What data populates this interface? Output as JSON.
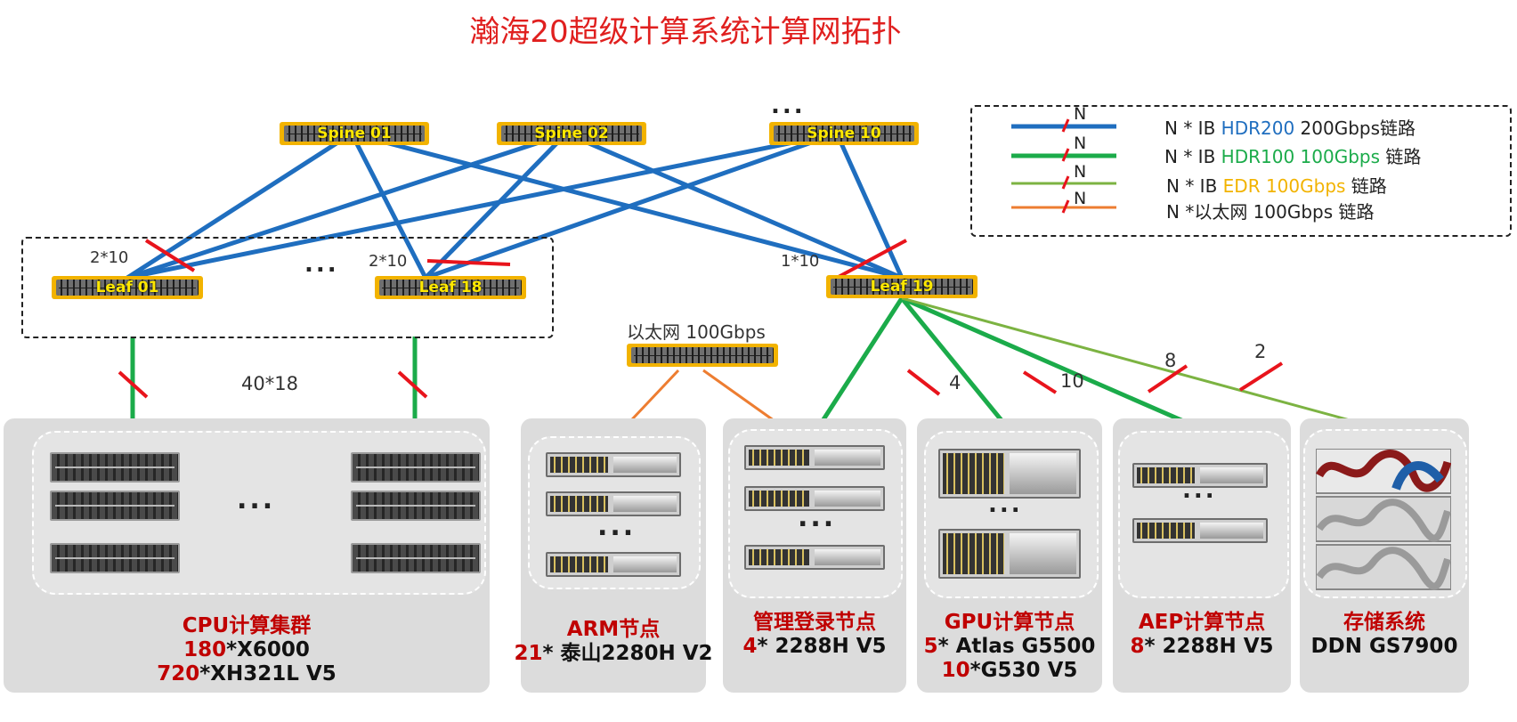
{
  "title": "瀚海20超级计算系统计算网拓扑",
  "colors": {
    "hdr200": "#1f6ebf",
    "hdr100": "#1bab4a",
    "edr": "#7cb342",
    "ethernet": "#ed7d31",
    "switch_frame": "#f2b300",
    "switch_label": "#ffe800",
    "caption_red": "#c00000",
    "slash": "#e8141c"
  },
  "switches": {
    "spine01": "Spine 01",
    "spine02": "Spine 02",
    "spine10": "Spine 10",
    "leaf01": "Leaf 01",
    "leaf18": "Leaf 18",
    "leaf19": "Leaf 19"
  },
  "ellipsis": "...",
  "link_counts": {
    "leaf01": "2*10",
    "leaf18": "2*10",
    "leaf19": "1*10",
    "cpu": "40*18",
    "gpu_hdr100_a": "4",
    "gpu_hdr100_b": "10",
    "aep_hdr100": "8",
    "storage_edr": "2"
  },
  "ethernet_switch_label": "以太网 100Gbps",
  "legend": {
    "marker": "N",
    "rows": [
      {
        "prefix": "N * IB ",
        "highlight": "HDR200",
        "highlight_color": "#1f6ebf",
        "suffix": " 200Gbps链路"
      },
      {
        "prefix": "N * IB ",
        "highlight": "HDR100 100Gbps",
        "highlight_color": "#1bab4a",
        "suffix": " 链路"
      },
      {
        "prefix": "N * IB ",
        "highlight": "EDR 100Gbps",
        "highlight_color": "#f2b300",
        "suffix": " 链路"
      },
      {
        "prefix": "N *以太网 100Gbps 链路",
        "highlight": "",
        "highlight_color": "#222222",
        "suffix": ""
      }
    ]
  },
  "groups": [
    {
      "name": "CPU计算集群",
      "lines": [
        {
          "count": "180",
          "model": "*X6000"
        },
        {
          "count": "720",
          "model": "*XH321L V5"
        }
      ]
    },
    {
      "name": "ARM节点",
      "lines": [
        {
          "count": "21",
          "model": "* 泰山2280H V2"
        }
      ]
    },
    {
      "name": "管理登录节点",
      "lines": [
        {
          "count": "4",
          "model": "* 2288H V5"
        }
      ]
    },
    {
      "name": "GPU计算节点",
      "lines": [
        {
          "count": "5",
          "model": "* Atlas G5500"
        },
        {
          "count": "10",
          "model": "*G530 V5"
        }
      ]
    },
    {
      "name": "AEP计算节点",
      "lines": [
        {
          "count": "8",
          "model": "* 2288H V5"
        }
      ]
    },
    {
      "name": "存储系统",
      "lines": [
        {
          "count": "",
          "model": "DDN GS7900"
        }
      ]
    }
  ]
}
